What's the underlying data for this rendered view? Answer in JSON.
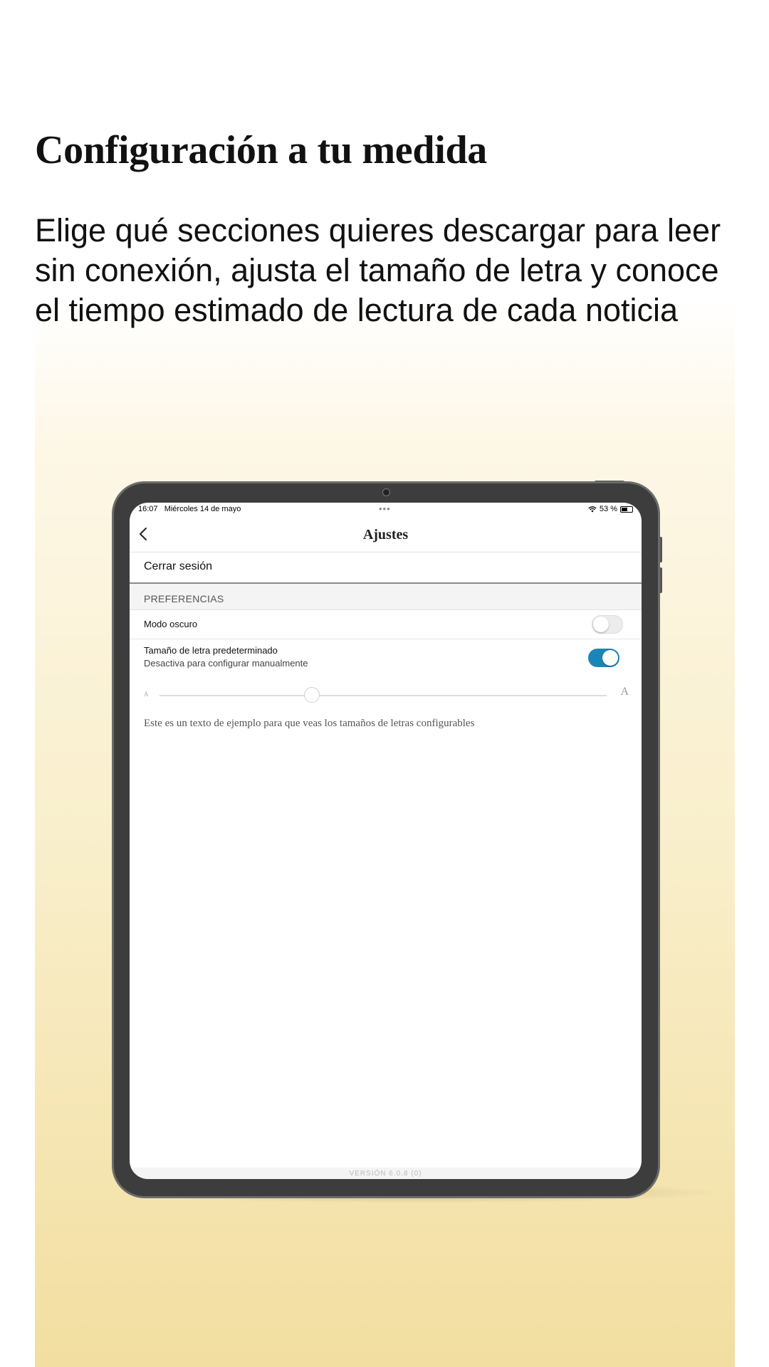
{
  "promo": {
    "headline": "Configuración a tu medida",
    "subtitle": "Elige qué secciones quieres descargar para leer sin conexión, ajusta el tamaño de letra y conoce el tiempo estimado de lectura de cada noticia"
  },
  "status_bar": {
    "time": "16:07",
    "date": "Miércoles 14 de mayo",
    "multitask_dots": "•••",
    "battery_label": "53 %"
  },
  "nav": {
    "back_icon": "chevron-left-icon",
    "title": "Ajustes"
  },
  "settings": {
    "logout_label": "Cerrar sesión",
    "section_header": "PREFERENCIAS",
    "dark_mode": {
      "label": "Modo oscuro",
      "enabled": false
    },
    "default_font_size": {
      "label": "Tamaño de letra predeterminado",
      "sublabel": "Desactiva para configurar manualmente",
      "enabled": true
    },
    "font_slider": {
      "min_label": "A",
      "max_label": "A",
      "value_fraction": 0.34
    },
    "sample_text": "Este es un texto de ejemplo para que veas los tamaños de letras configurables",
    "version": "VERSIÓN 6.0.8 (0)"
  },
  "colors": {
    "accent": "#1a86b8",
    "background_gradient_bottom": "#f2dea0"
  }
}
